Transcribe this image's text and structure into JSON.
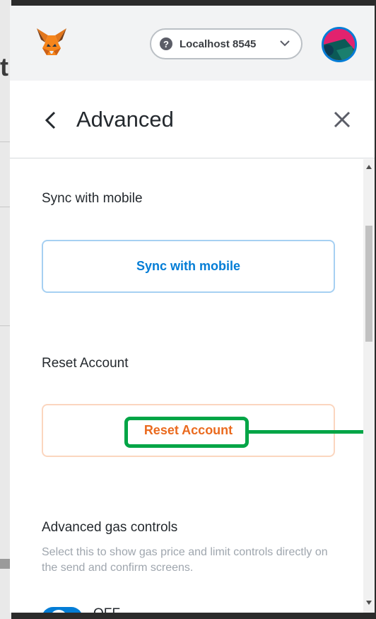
{
  "backdrop": {
    "glyph": "t"
  },
  "header": {
    "network": {
      "name": "Localhost 8545",
      "help_glyph": "?"
    }
  },
  "icons": {
    "logo": "metamask-fox-icon",
    "help": "help-circle-icon",
    "network_dropdown": "chevron-down-icon",
    "back": "chevron-left-icon",
    "close": "close-icon",
    "avatar": "account-identicon"
  },
  "settings": {
    "title": "Advanced",
    "sync": {
      "label": "Sync with mobile",
      "button": "Sync with mobile"
    },
    "reset": {
      "label": "Reset Account",
      "button": "Reset Account"
    },
    "gas": {
      "label": "Advanced gas controls",
      "description": "Select this to show gas price and limit controls directly on the send and confirm screens.",
      "toggle_state": "OFF"
    }
  },
  "colors": {
    "accent_blue": "#037dd6",
    "reset_orange": "#ea6a1e",
    "highlight_green": "#00a546",
    "header_bg": "#f2f3f4"
  }
}
